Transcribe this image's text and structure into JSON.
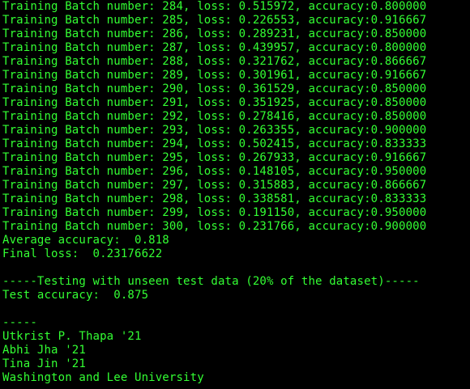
{
  "terminal": {
    "text_color": "#33ff33",
    "background": "#000000",
    "lines": [
      "Training Batch number: 284, loss: 0.515972, accuracy:0.800000",
      "Training Batch number: 285, loss: 0.226553, accuracy:0.916667",
      "Training Batch number: 286, loss: 0.289231, accuracy:0.850000",
      "Training Batch number: 287, loss: 0.439957, accuracy:0.800000",
      "Training Batch number: 288, loss: 0.321762, accuracy:0.866667",
      "Training Batch number: 289, loss: 0.301961, accuracy:0.916667",
      "Training Batch number: 290, loss: 0.361529, accuracy:0.850000",
      "Training Batch number: 291, loss: 0.351925, accuracy:0.850000",
      "Training Batch number: 292, loss: 0.278416, accuracy:0.850000",
      "Training Batch number: 293, loss: 0.263355, accuracy:0.900000",
      "Training Batch number: 294, loss: 0.502415, accuracy:0.833333",
      "Training Batch number: 295, loss: 0.267933, accuracy:0.916667",
      "Training Batch number: 296, loss: 0.148105, accuracy:0.950000",
      "Training Batch number: 297, loss: 0.315883, accuracy:0.866667",
      "Training Batch number: 298, loss: 0.338581, accuracy:0.833333",
      "Training Batch number: 299, loss: 0.191150, accuracy:0.950000",
      "Training Batch number: 300, loss: 0.231766, accuracy:0.900000",
      "Average accuracy:  0.818",
      "Final loss:  0.23176622",
      "",
      "-----Testing with unseen test data (20% of the dataset)-----",
      "Test accuracy:  0.875",
      "",
      "-----",
      "Utkrist P. Thapa '21",
      "Abhi Jha '21",
      "Tina Jin '21",
      "Washington and Lee University"
    ]
  }
}
